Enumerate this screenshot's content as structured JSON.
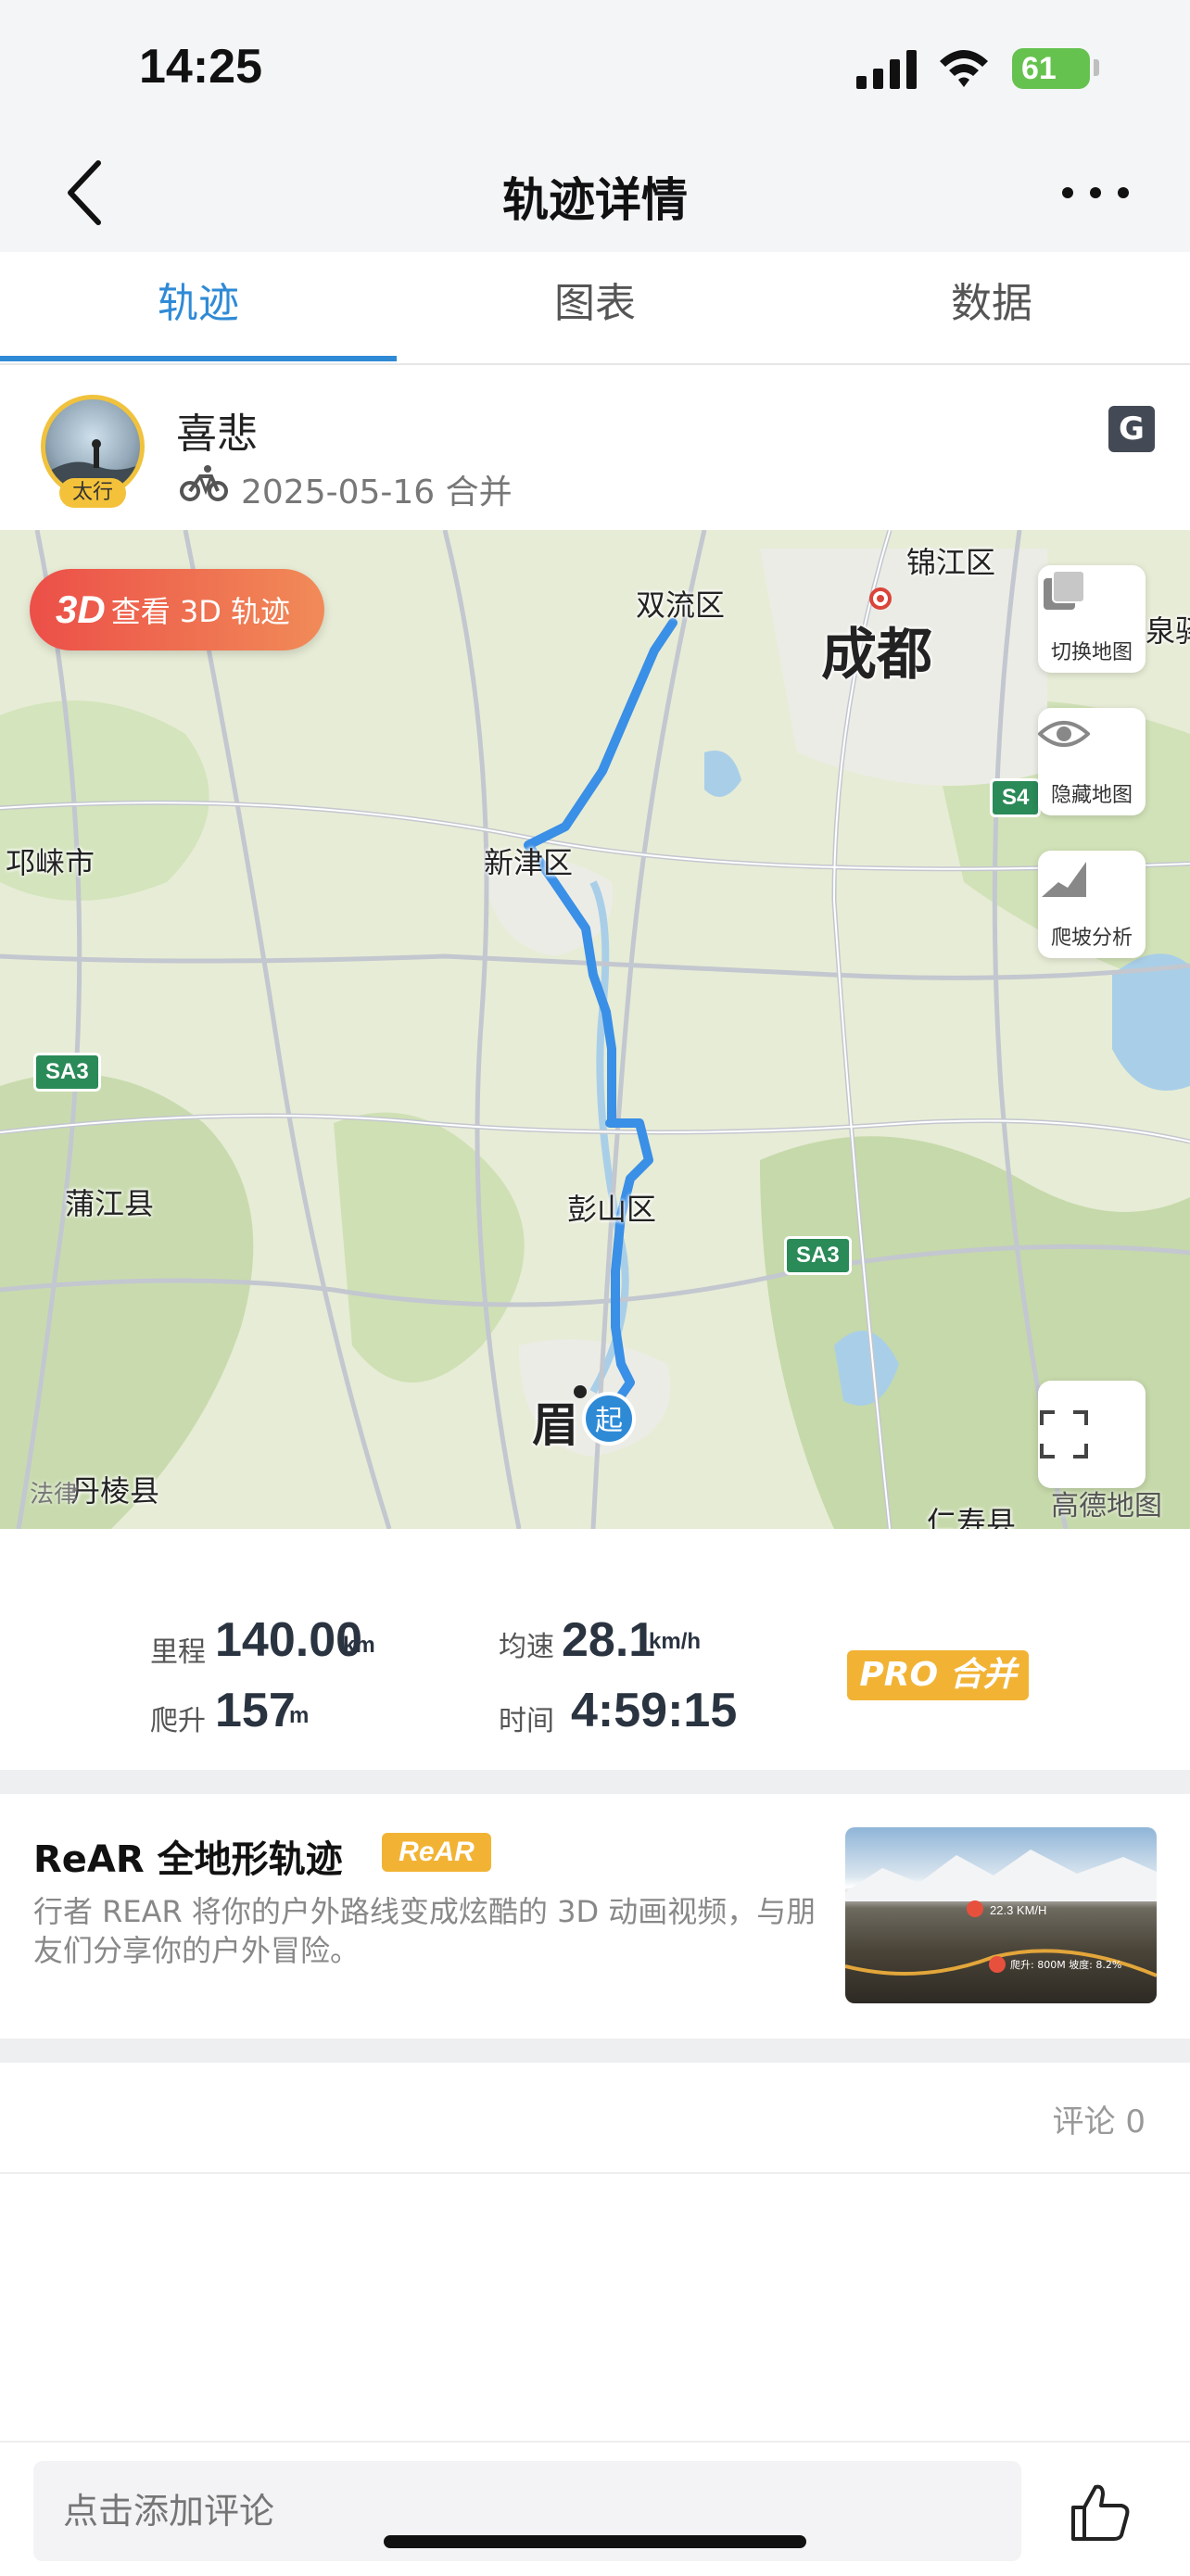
{
  "status_bar": {
    "time": "14:25",
    "battery": "61"
  },
  "header": {
    "title": "轨迹详情"
  },
  "tabs": [
    {
      "label": "轨迹",
      "active": true
    },
    {
      "label": "图表",
      "active": false
    },
    {
      "label": "数据",
      "active": false
    }
  ],
  "user": {
    "name": "喜悲",
    "badge": "太行",
    "date_line": "2025-05-16 合并",
    "app_badge": "G"
  },
  "map": {
    "btn_3d_mark": "3D",
    "btn_3d_label": "查看 3D 轨迹",
    "controls": [
      "切换地图",
      "隐藏地图",
      "爬坡分析"
    ],
    "places": {
      "jinjiang": "锦江区",
      "shuangliu": "双流区",
      "chengdu": "成都",
      "longquan": "泉驿",
      "qionglai": "邛崃市",
      "xinjin": "新津区",
      "pujiang": "蒲江县",
      "pengshan": "彭山区",
      "meishan": "眉",
      "danling": "丹棱县",
      "renshou": "仁寿县"
    },
    "shields": [
      "S4",
      "SA3",
      "SA3"
    ],
    "start_label": "起",
    "provider": "高德地图",
    "law_mark": "法律"
  },
  "stats": {
    "distance": {
      "label": "里程",
      "value": "140.00",
      "unit": "km"
    },
    "speed": {
      "label": "均速",
      "value": "28.1",
      "unit": "km/h"
    },
    "climb": {
      "label": "爬升",
      "value": "157",
      "unit": "m"
    },
    "time": {
      "label": "时间",
      "value": "4:59:15"
    },
    "pro_badge": "PRO 合并"
  },
  "rear": {
    "title": "ReAR 全地形轨迹",
    "badge": "ReAR",
    "description": "行者 REAR 将你的户外路线变成炫酷的 3D 动画视频，与朋友们分享你的户外冒险。",
    "thumb_speed": "22.3 KM/H",
    "thumb_stats": "爬升: 800M 坡度: 8.2%"
  },
  "comments": {
    "count_label": "评论 0",
    "input_placeholder": "点击添加评论"
  }
}
